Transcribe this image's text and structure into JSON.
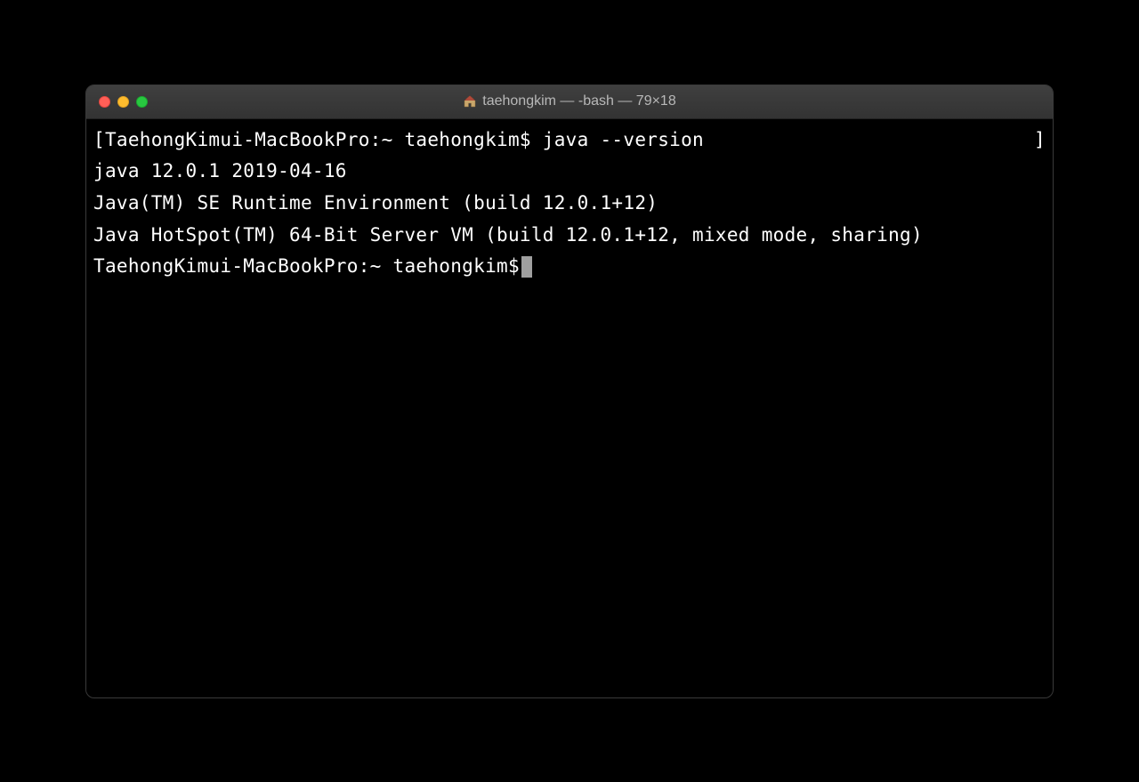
{
  "titlebar": {
    "title": "taehongkim — -bash — 79×18",
    "home_icon": "home-icon"
  },
  "terminal": {
    "lines": [
      "[TaehongKimui-MacBookPro:~ taehongkim$ java --version",
      "java 12.0.1 2019-04-16",
      "Java(TM) SE Runtime Environment (build 12.0.1+12)",
      "Java HotSpot(TM) 64-Bit Server VM (build 12.0.1+12, mixed mode, sharing)"
    ],
    "prompt": "TaehongKimui-MacBookPro:~ taehongkim$ ",
    "right_bracket": "]"
  }
}
